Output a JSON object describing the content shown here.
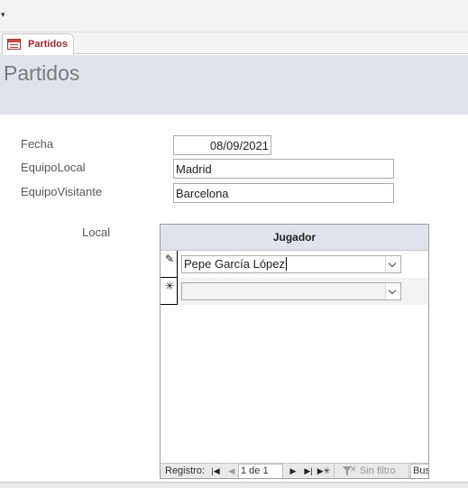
{
  "toolbar": {
    "dropdown_glyph": "▾"
  },
  "tab": {
    "label": "Partidos",
    "icon": "form-icon"
  },
  "form": {
    "title": "Partidos",
    "fields": {
      "fecha": {
        "label": "Fecha",
        "value": "08/09/2021"
      },
      "equipo_local": {
        "label": "EquipoLocal",
        "value": "Madrid"
      },
      "equipo_visitante": {
        "label": "EquipoVisitante",
        "value": "Barcelona"
      }
    }
  },
  "subform": {
    "label": "Local",
    "column_header": "Jugador",
    "rows": [
      {
        "selector": "✎",
        "value": "Pepe García López",
        "state": "editing"
      },
      {
        "selector": "✳",
        "value": "",
        "state": "new"
      }
    ],
    "navigation": {
      "record_label": "Registro:",
      "record_position": "1 de 1",
      "filter_label": "Sin filtro",
      "search_label": "Bus"
    }
  },
  "main_navigation": {
    "colors": {
      "bar": "#e9e9e9"
    }
  },
  "colors": {
    "accent": "#a4262c",
    "header": "#dfe3eb"
  }
}
